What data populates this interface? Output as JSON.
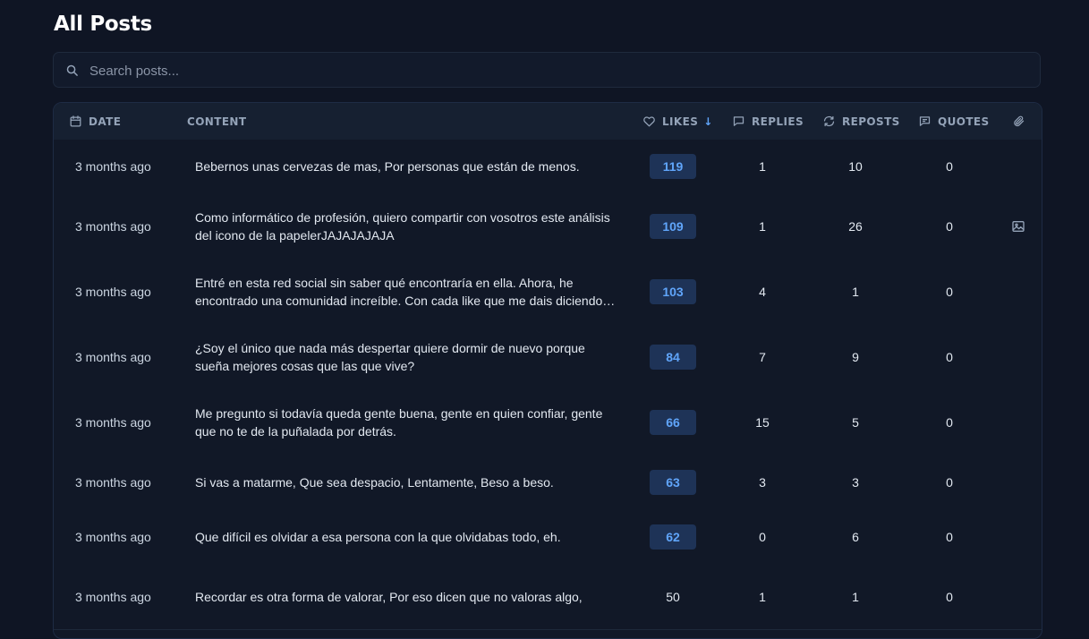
{
  "page": {
    "title": "All Posts"
  },
  "search": {
    "placeholder": "Search posts...",
    "value": ""
  },
  "columns": {
    "date": "DATE",
    "content": "CONTENT",
    "likes": "LIKES",
    "likes_sort": "↓",
    "replies": "REPLIES",
    "reposts": "REPOSTS",
    "quotes": "QUOTES"
  },
  "icons": {
    "search": "search-icon",
    "date": "calendar-icon",
    "likes": "heart-icon",
    "replies": "message-icon",
    "reposts": "repost-icon",
    "quotes": "quote-icon",
    "media": "paperclip-icon",
    "row_media": "image-icon"
  },
  "colors": {
    "background": "#0f1524",
    "accent": "#60a5fa",
    "badge_bg": "#1e3357"
  },
  "rows": [
    {
      "date": "3 months ago",
      "content": "Bebernos unas cervezas de mas, Por personas que están de menos.",
      "likes": "119",
      "replies": "1",
      "reposts": "10",
      "quotes": "0",
      "media": false
    },
    {
      "date": "3 months ago",
      "content": "Como informático de profesión, quiero compartir con vosotros este análisis del icono de la papelerJAJAJAJAJA",
      "likes": "109",
      "replies": "1",
      "reposts": "26",
      "quotes": "0",
      "media": true
    },
    {
      "date": "3 months ago",
      "content": "Entré en esta red social sin saber qué encontraría en ella. Ahora, he encontrado una comunidad increíble. Con cada like que me dais diciendo que os gustan mis publicaciones",
      "likes": "103",
      "replies": "4",
      "reposts": "1",
      "quotes": "0",
      "media": false
    },
    {
      "date": "3 months ago",
      "content": "¿Soy el único que nada más despertar quiere dormir de nuevo porque sueña mejores cosas que las que vive?",
      "likes": "84",
      "replies": "7",
      "reposts": "9",
      "quotes": "0",
      "media": false
    },
    {
      "date": "3 months ago",
      "content": "Me pregunto si todavía queda gente buena, gente en quien confiar, gente que no te de la puñalada por detrás.",
      "likes": "66",
      "replies": "15",
      "reposts": "5",
      "quotes": "0",
      "media": false
    },
    {
      "date": "3 months ago",
      "content": "Si vas a matarme, Que sea despacio, Lentamente, Beso a beso.",
      "likes": "63",
      "replies": "3",
      "reposts": "3",
      "quotes": "0",
      "media": false
    },
    {
      "date": "3 months ago",
      "content": "Que difícil es olvidar a esa persona con la que olvidabas todo, eh.",
      "likes": "62",
      "replies": "0",
      "reposts": "6",
      "quotes": "0",
      "media": false
    },
    {
      "date": "3 months ago",
      "content": "Recordar es otra forma de valorar, Por eso dicen que no valoras algo,",
      "likes": "50",
      "replies": "1",
      "reposts": "1",
      "quotes": "0",
      "media": false
    }
  ]
}
